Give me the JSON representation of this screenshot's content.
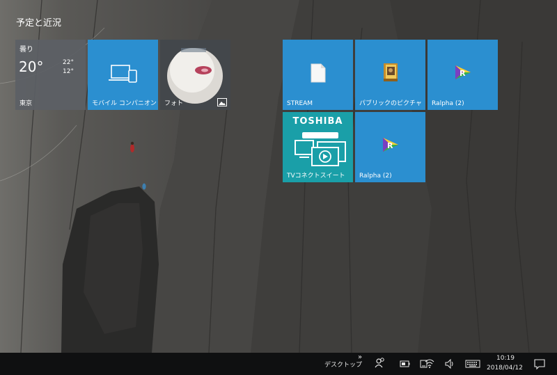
{
  "start": {
    "group_title": "予定と近況",
    "weather": {
      "condition": "曇り",
      "temperature": "20°",
      "high": "22°",
      "low": "12°",
      "city": "東京"
    },
    "tiles": {
      "mobile": {
        "label": "モバイル コンパニオン",
        "icon": "laptop-phone-icon"
      },
      "photo": {
        "label": "フォト",
        "icon": "photos-icon"
      },
      "stream": {
        "label": "STREAM",
        "icon": "document-icon"
      },
      "public_pictures": {
        "label": "パブリックのピクチャ",
        "icon": "folder-pictures-icon"
      },
      "ralpha1": {
        "label": "Ralpha (2)",
        "icon": "ralpha-icon"
      },
      "tvconnect": {
        "label": "TVコネクトスイート",
        "brand": "TOSHIBA",
        "icon": "tv-connect-icon"
      },
      "ralpha2": {
        "label": "Ralpha (2)",
        "icon": "ralpha-icon"
      }
    }
  },
  "taskbar": {
    "desktop_label": "デスクトップ",
    "overflow_chevron": "»",
    "time": "10:19",
    "date": "2018/04/12",
    "icons": [
      "people-icon",
      "battery-icon",
      "tablet-icon",
      "wifi-icon",
      "volume-icon",
      "keyboard-icon",
      "action-center-icon"
    ]
  },
  "colors": {
    "tile_blue": "#2b8fd0",
    "tile_teal": "#1a9fa8",
    "taskbar": "#0f1011"
  }
}
